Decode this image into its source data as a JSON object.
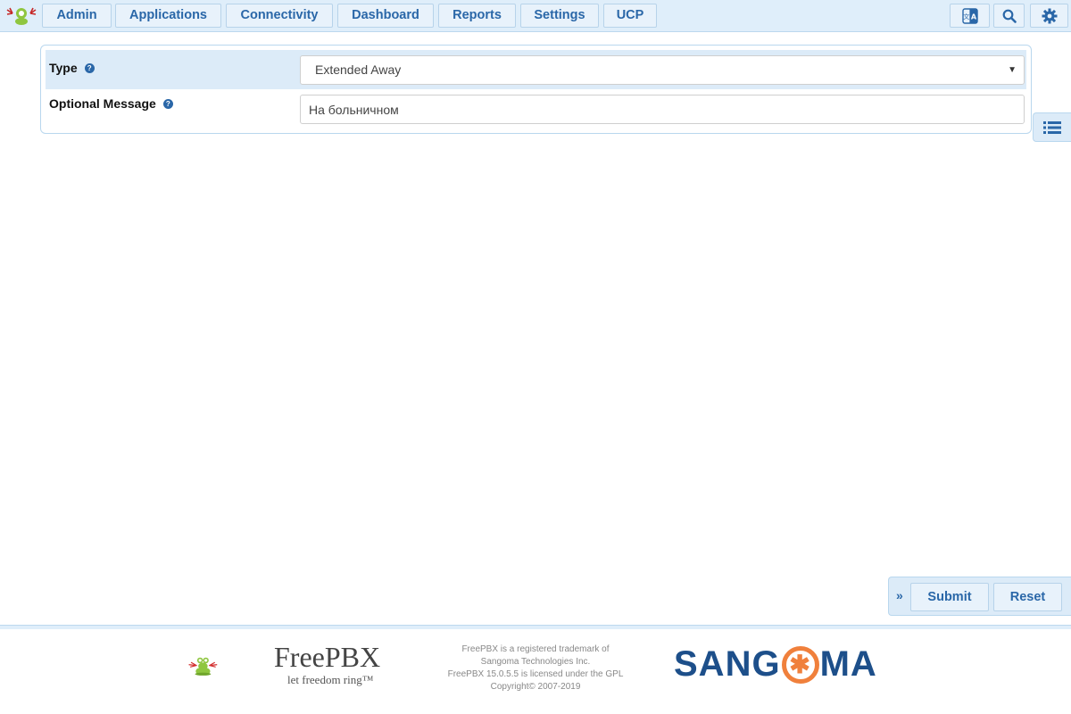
{
  "nav": {
    "items": [
      "Admin",
      "Applications",
      "Connectivity",
      "Dashboard",
      "Reports",
      "Settings",
      "UCP"
    ]
  },
  "form": {
    "type_label": "Type",
    "type_value": "Extended Away",
    "message_label": "Optional Message",
    "message_value": "На больничном"
  },
  "actions": {
    "submit": "Submit",
    "reset": "Reset"
  },
  "footer": {
    "brand": "FreePBX",
    "tagline": "let freedom ring™",
    "line1": "FreePBX is a registered trademark of",
    "line2": "Sangoma Technologies Inc.",
    "line3": "FreePBX 15.0.5.5 is licensed under the GPL",
    "line4": "Copyright© 2007-2019",
    "sangoma_left": "SANG",
    "sangoma_right": "MA"
  },
  "icons": {
    "translate": "translate-icon",
    "search": "search-icon",
    "settings": "gear-icon",
    "sidebar": "list-icon"
  },
  "colors": {
    "accent": "#2a67a8",
    "nav_bg": "#dfeefa",
    "row_shade": "#dcebf8",
    "sangoma_blue": "#1d4f8a",
    "sangoma_orange": "#f0803c"
  }
}
